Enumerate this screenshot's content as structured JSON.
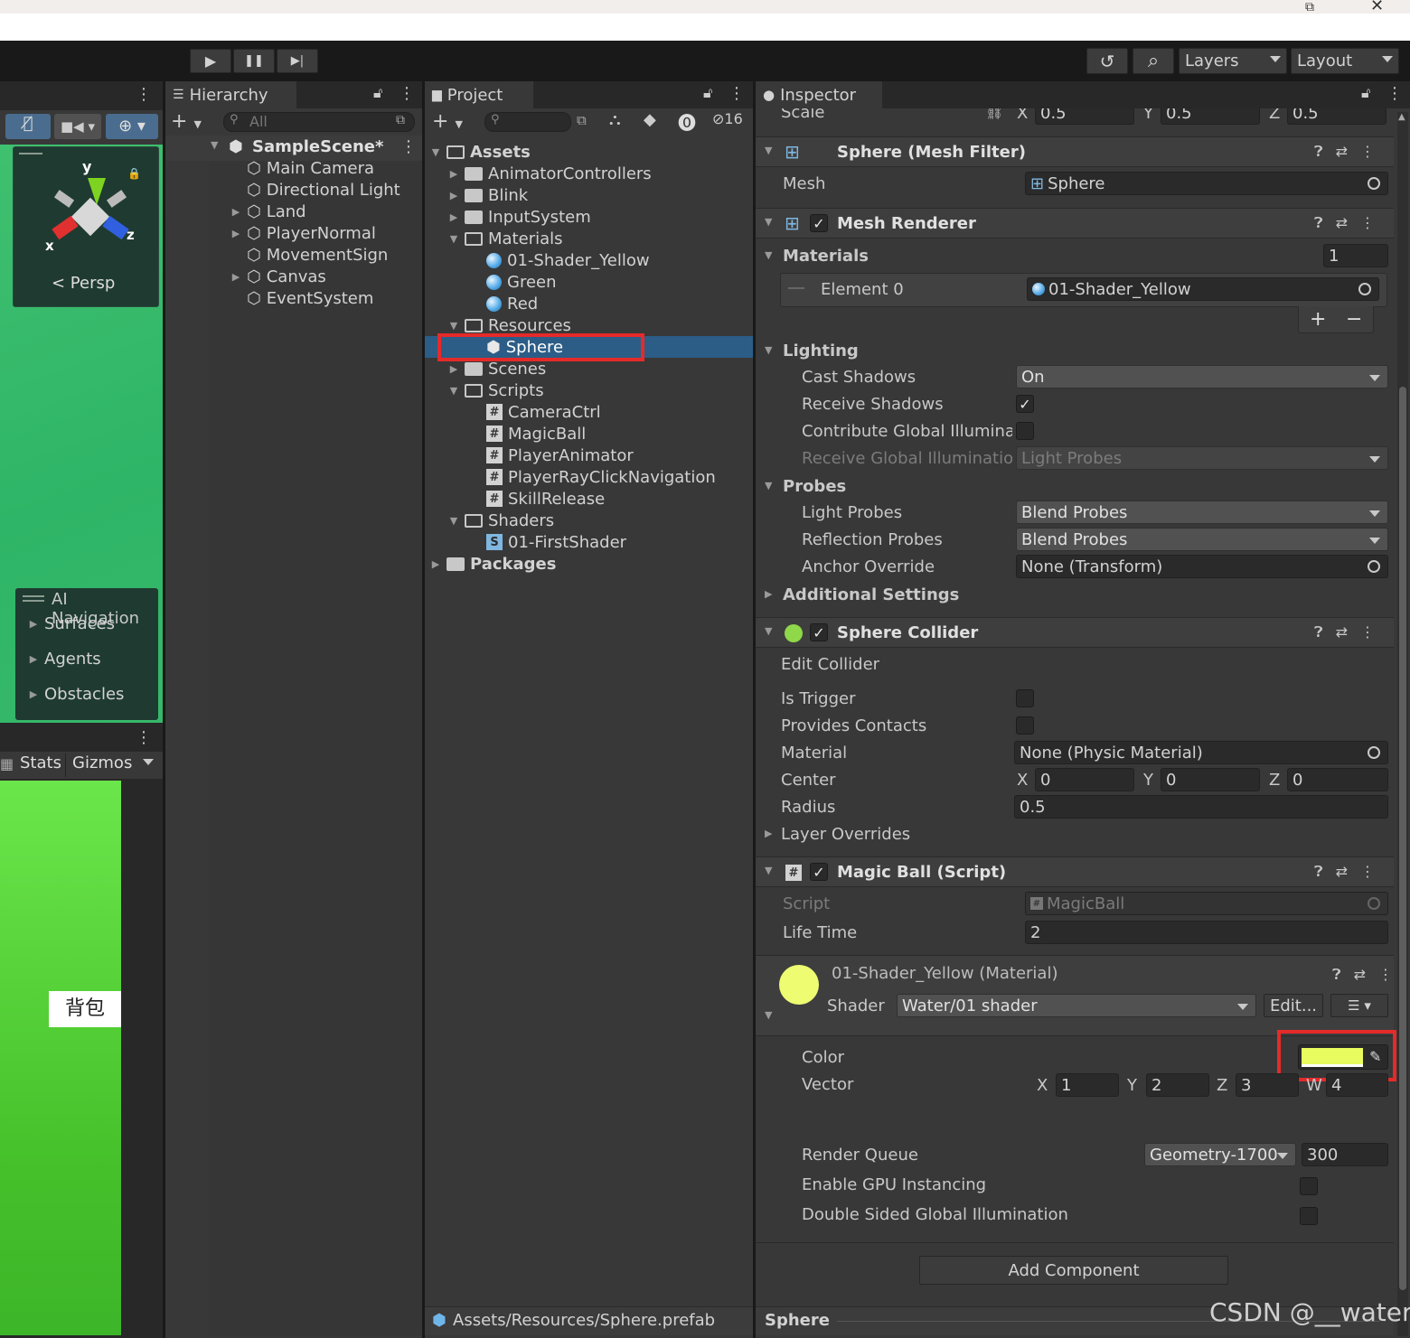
{
  "toolbar": {
    "play": "▶",
    "pause": "❚❚",
    "step": "▶|",
    "history_icon": "↺",
    "search_icon": "⌕",
    "layers": "Layers",
    "layout": "Layout"
  },
  "scene": {
    "axis_y": "y",
    "axis_x": "x",
    "axis_z": "z",
    "persp": "< Persp",
    "ai_nav": "AI Navigation",
    "ai_items": [
      "Surfaces",
      "Agents",
      "Obstacles"
    ],
    "stats": "Stats",
    "gizmos": "Gizmos",
    "backpack": "背包"
  },
  "hierarchy": {
    "tab": "Hierarchy",
    "search": "All",
    "scene": "SampleScene*",
    "items": [
      "Main Camera",
      "Directional Light",
      "Land",
      "PlayerNormal",
      "MovementSign",
      "Canvas",
      "EventSystem"
    ]
  },
  "project": {
    "tab": "Project",
    "hidden_count": "16",
    "root": "Assets",
    "folders": [
      "AnimatorControllers",
      "Blink",
      "InputSystem",
      "Materials"
    ],
    "materials": [
      "01-Shader_Yellow",
      "Green",
      "Red"
    ],
    "resources": "Resources",
    "resource_items": [
      "Sphere"
    ],
    "folders2": [
      "Scenes",
      "Scripts"
    ],
    "scripts": [
      "CameraCtrl",
      "MagicBall",
      "PlayerAnimator",
      "PlayerRayClickNavigation",
      "SkillRelease"
    ],
    "shaders": "Shaders",
    "shader_items": [
      "01-FirstShader"
    ],
    "packages": "Packages",
    "footer": "Assets/Resources/Sphere.prefab"
  },
  "inspector": {
    "tab": "Inspector",
    "scale": {
      "label": "Scale",
      "x": "0.5",
      "y": "0.5",
      "z": "0.5"
    },
    "mesh_filter": {
      "title": "Sphere (Mesh Filter)",
      "mesh_label": "Mesh",
      "mesh_value": "Sphere"
    },
    "mesh_renderer": {
      "title": "Mesh Renderer",
      "materials_label": "Materials",
      "materials_count": "1",
      "element0": "Element 0",
      "element0_value": "01-Shader_Yellow",
      "add": "+",
      "remove": "−",
      "lighting": "Lighting",
      "cast_shadows": "Cast Shadows",
      "cast_shadows_value": "On",
      "receive_shadows": "Receive Shadows",
      "contribute_gi": "Contribute Global Illuminat",
      "receive_gi": "Receive Global Illuminatior",
      "receive_gi_value": "Light Probes",
      "probes": "Probes",
      "light_probes": "Light Probes",
      "light_probes_value": "Blend Probes",
      "reflection_probes": "Reflection Probes",
      "reflection_probes_value": "Blend Probes",
      "anchor_override": "Anchor Override",
      "anchor_override_value": "None (Transform)",
      "additional": "Additional Settings"
    },
    "sphere_collider": {
      "title": "Sphere Collider",
      "edit": "Edit Collider",
      "is_trigger": "Is Trigger",
      "provides_contacts": "Provides Contacts",
      "material": "Material",
      "material_value": "None (Physic Material)",
      "center": "Center",
      "cx": "0",
      "cy": "0",
      "cz": "0",
      "radius": "Radius",
      "radius_value": "0.5",
      "layer_overrides": "Layer Overrides"
    },
    "magic_ball": {
      "title": "Magic Ball (Script)",
      "script": "Script",
      "script_value": "MagicBall",
      "life_time": "Life Time",
      "life_time_value": "2"
    },
    "material": {
      "title": "01-Shader_Yellow (Material)",
      "shader_label": "Shader",
      "shader_value": "Water/01 shader",
      "edit": "Edit...",
      "color": "Color",
      "color_value": "#e8fb5f",
      "vector": "Vector",
      "vx": "1",
      "vy": "2",
      "vz": "3",
      "vw": "4",
      "render_queue": "Render Queue",
      "render_queue_value": "Geometry-1700",
      "render_queue_num": "300",
      "gpu_instancing": "Enable GPU Instancing",
      "double_sided": "Double Sided Global Illumination"
    },
    "add_component": "Add Component",
    "footer": "Sphere"
  },
  "watermark": "CSDN @__water"
}
